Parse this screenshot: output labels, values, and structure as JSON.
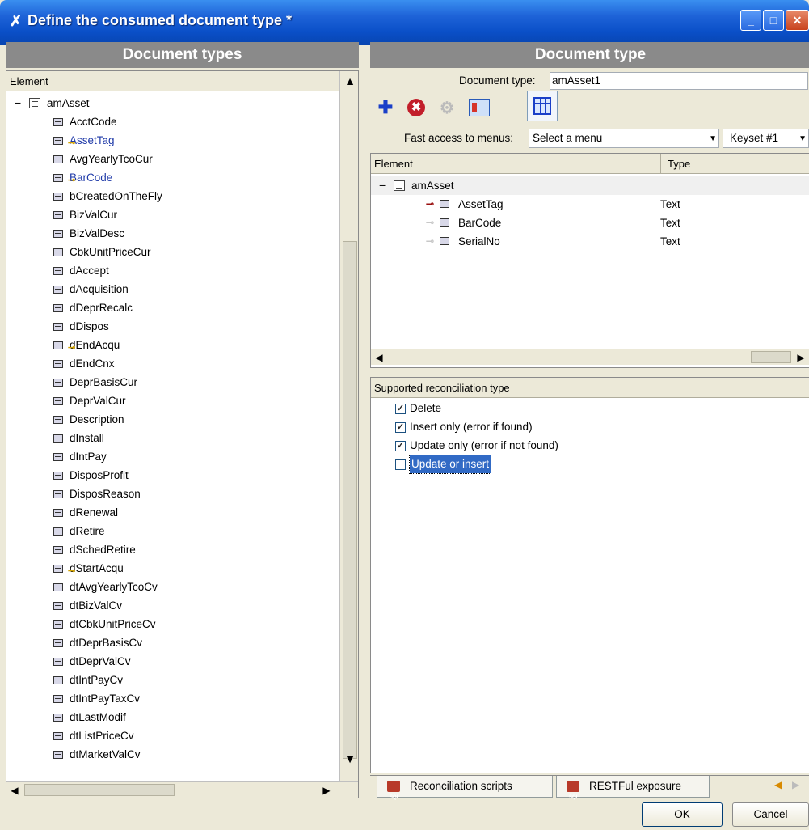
{
  "window": {
    "title": "Define the consumed document type *",
    "icon": "feather-icon"
  },
  "left_panel": {
    "header": "Document types",
    "column": "Element",
    "root": "amAsset",
    "items": [
      {
        "label": "AcctCode",
        "key": false
      },
      {
        "label": "AssetTag",
        "key": true,
        "highlight": true
      },
      {
        "label": "AvgYearlyTcoCur",
        "key": false
      },
      {
        "label": "BarCode",
        "key": true,
        "highlight": true
      },
      {
        "label": "bCreatedOnTheFly",
        "key": false
      },
      {
        "label": "BizValCur",
        "key": false
      },
      {
        "label": "BizValDesc",
        "key": false
      },
      {
        "label": "CbkUnitPriceCur",
        "key": false
      },
      {
        "label": "dAccept",
        "key": false
      },
      {
        "label": "dAcquisition",
        "key": false
      },
      {
        "label": "dDeprRecalc",
        "key": false
      },
      {
        "label": "dDispos",
        "key": false
      },
      {
        "label": "dEndAcqu",
        "key": true
      },
      {
        "label": "dEndCnx",
        "key": false
      },
      {
        "label": "DeprBasisCur",
        "key": false
      },
      {
        "label": "DeprValCur",
        "key": false
      },
      {
        "label": "Description",
        "key": false
      },
      {
        "label": "dInstall",
        "key": false
      },
      {
        "label": "dIntPay",
        "key": false
      },
      {
        "label": "DisposProfit",
        "key": false
      },
      {
        "label": "DisposReason",
        "key": false
      },
      {
        "label": "dRenewal",
        "key": false
      },
      {
        "label": "dRetire",
        "key": false
      },
      {
        "label": "dSchedRetire",
        "key": false
      },
      {
        "label": "dStartAcqu",
        "key": true
      },
      {
        "label": "dtAvgYearlyTcoCv",
        "key": false
      },
      {
        "label": "dtBizValCv",
        "key": false
      },
      {
        "label": "dtCbkUnitPriceCv",
        "key": false
      },
      {
        "label": "dtDeprBasisCv",
        "key": false
      },
      {
        "label": "dtDeprValCv",
        "key": false
      },
      {
        "label": "dtIntPayCv",
        "key": false
      },
      {
        "label": "dtIntPayTaxCv",
        "key": false
      },
      {
        "label": "dtLastModif",
        "key": false
      },
      {
        "label": "dtListPriceCv",
        "key": false
      },
      {
        "label": "dtMarketValCv",
        "key": false
      }
    ]
  },
  "right_panel": {
    "header": "Document type",
    "doc_type_label": "Document type:",
    "doc_type_value": "amAsset1",
    "fast_access_label": "Fast access to menus:",
    "menu_select": "Select a menu",
    "keyset": "Keyset #1",
    "tree": {
      "col_element": "Element",
      "col_type": "Type",
      "root": "amAsset",
      "items": [
        {
          "label": "AssetTag",
          "type": "Text",
          "primary": true
        },
        {
          "label": "BarCode",
          "type": "Text",
          "primary": false
        },
        {
          "label": "SerialNo",
          "type": "Text",
          "primary": false
        }
      ]
    },
    "reconciliation": {
      "header": "Supported reconciliation type",
      "options": [
        {
          "label": "Delete",
          "checked": true
        },
        {
          "label": "Insert only (error if found)",
          "checked": true
        },
        {
          "label": "Update only (error if not found)",
          "checked": true
        },
        {
          "label": "Update or insert",
          "checked": false
        }
      ]
    },
    "tabs": [
      "Reconciliation scripts",
      "RESTFul exposure"
    ]
  },
  "buttons": {
    "ok": "OK",
    "cancel": "Cancel"
  },
  "glyphs": {
    "expand": "−",
    "up": "▲",
    "down": "▼",
    "left": "◀",
    "right": "▶",
    "dropdown": "▼",
    "add": "✚",
    "delete": "✖",
    "props": "⚙",
    "minimize": "_",
    "maximize": "□",
    "close": "✕",
    "check": "✓",
    "key": "⊸",
    "nav_prev": "◀",
    "nav_next": "▶",
    "app": "✗"
  }
}
